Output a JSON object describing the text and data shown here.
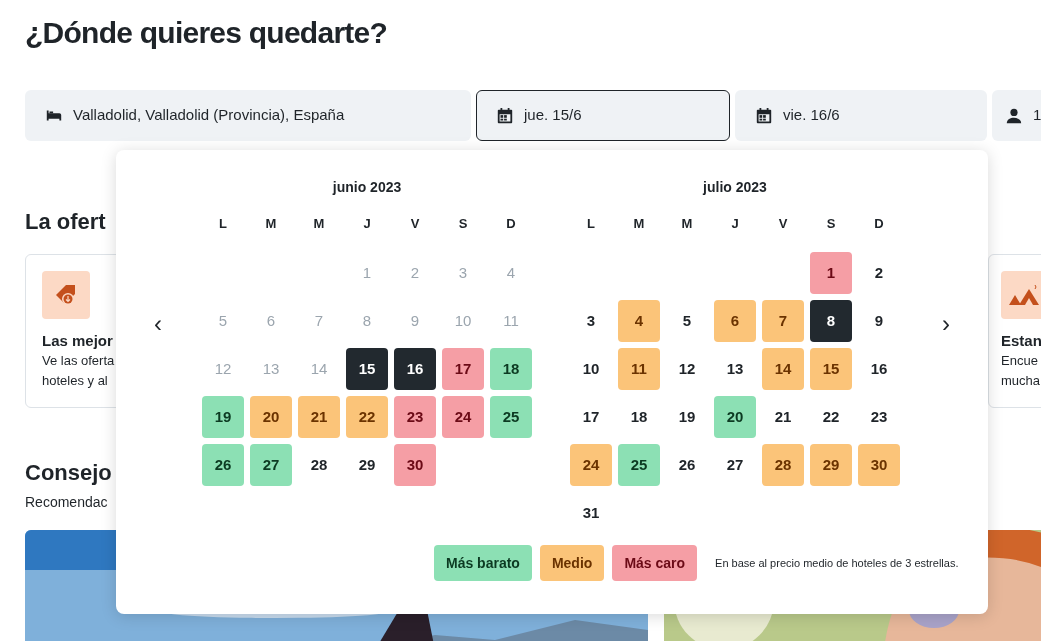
{
  "title": "¿Dónde quieres quedarte?",
  "search_fields": [
    {
      "kind": "location",
      "value": "Valladolid, Valladolid (Provincia), España",
      "selected": false
    },
    {
      "kind": "date",
      "value": "jue. 15/6",
      "selected": true
    },
    {
      "kind": "date",
      "value": "vie. 16/6",
      "selected": false
    },
    {
      "kind": "guests",
      "value": "1",
      "selected": false
    }
  ],
  "offers": {
    "heading": "La ofert",
    "cards": [
      {
        "title": "Las mejor",
        "text_lines": [
          "Ve las oferta",
          "hoteles y al"
        ]
      },
      {
        "title": "Estan",
        "text_lines": [
          "Encue",
          "mucha"
        ]
      }
    ]
  },
  "tips": {
    "heading": "Consejo",
    "subtitle": "Recomendac"
  },
  "calendar": {
    "prev": "‹",
    "next": "›",
    "months": [
      {
        "title": "junio 2023",
        "weekdays": [
          "L",
          "M",
          "M",
          "J",
          "V",
          "S",
          "D"
        ],
        "weeks": [
          [
            {
              "kind": "empty"
            },
            {
              "kind": "empty"
            },
            {
              "kind": "empty"
            },
            {
              "d": "1",
              "kind": "past"
            },
            {
              "d": "2",
              "kind": "past"
            },
            {
              "d": "3",
              "kind": "past"
            },
            {
              "d": "4",
              "kind": "past"
            }
          ],
          [
            {
              "d": "5",
              "kind": "past"
            },
            {
              "d": "6",
              "kind": "past"
            },
            {
              "d": "7",
              "kind": "past"
            },
            {
              "d": "8",
              "kind": "past"
            },
            {
              "d": "9",
              "kind": "past"
            },
            {
              "d": "10",
              "kind": "past"
            },
            {
              "d": "11",
              "kind": "past"
            }
          ],
          [
            {
              "d": "12",
              "kind": "past"
            },
            {
              "d": "13",
              "kind": "past"
            },
            {
              "d": "14",
              "kind": "past"
            },
            {
              "d": "15",
              "kind": "selected"
            },
            {
              "d": "16",
              "kind": "selected"
            },
            {
              "d": "17",
              "kind": "expensive"
            },
            {
              "d": "18",
              "kind": "cheap"
            }
          ],
          [
            {
              "d": "19",
              "kind": "cheap"
            },
            {
              "d": "20",
              "kind": "medium"
            },
            {
              "d": "21",
              "kind": "medium"
            },
            {
              "d": "22",
              "kind": "medium"
            },
            {
              "d": "23",
              "kind": "expensive"
            },
            {
              "d": "24",
              "kind": "expensive"
            },
            {
              "d": "25",
              "kind": "cheap"
            }
          ],
          [
            {
              "d": "26",
              "kind": "cheap"
            },
            {
              "d": "27",
              "kind": "cheap"
            },
            {
              "d": "28",
              "kind": "plain"
            },
            {
              "d": "29",
              "kind": "plain"
            },
            {
              "d": "30",
              "kind": "expensive"
            }
          ]
        ]
      },
      {
        "title": "julio 2023",
        "weekdays": [
          "L",
          "M",
          "M",
          "J",
          "V",
          "S",
          "D"
        ],
        "weeks": [
          [
            {
              "kind": "empty"
            },
            {
              "kind": "empty"
            },
            {
              "kind": "empty"
            },
            {
              "kind": "empty"
            },
            {
              "kind": "empty"
            },
            {
              "d": "1",
              "kind": "expensive"
            },
            {
              "d": "2",
              "kind": "plain"
            }
          ],
          [
            {
              "d": "3",
              "kind": "plain"
            },
            {
              "d": "4",
              "kind": "medium"
            },
            {
              "d": "5",
              "kind": "plain"
            },
            {
              "d": "6",
              "kind": "medium"
            },
            {
              "d": "7",
              "kind": "medium"
            },
            {
              "d": "8",
              "kind": "selected"
            },
            {
              "d": "9",
              "kind": "plain"
            }
          ],
          [
            {
              "d": "10",
              "kind": "plain"
            },
            {
              "d": "11",
              "kind": "medium"
            },
            {
              "d": "12",
              "kind": "plain"
            },
            {
              "d": "13",
              "kind": "plain"
            },
            {
              "d": "14",
              "kind": "medium"
            },
            {
              "d": "15",
              "kind": "medium"
            },
            {
              "d": "16",
              "kind": "plain"
            }
          ],
          [
            {
              "d": "17",
              "kind": "plain"
            },
            {
              "d": "18",
              "kind": "plain"
            },
            {
              "d": "19",
              "kind": "plain"
            },
            {
              "d": "20",
              "kind": "cheap"
            },
            {
              "d": "21",
              "kind": "plain"
            },
            {
              "d": "22",
              "kind": "plain"
            },
            {
              "d": "23",
              "kind": "plain"
            }
          ],
          [
            {
              "d": "24",
              "kind": "medium"
            },
            {
              "d": "25",
              "kind": "cheap"
            },
            {
              "d": "26",
              "kind": "plain"
            },
            {
              "d": "27",
              "kind": "plain"
            },
            {
              "d": "28",
              "kind": "medium"
            },
            {
              "d": "29",
              "kind": "medium"
            },
            {
              "d": "30",
              "kind": "medium"
            }
          ],
          [
            {
              "d": "31",
              "kind": "plain"
            }
          ]
        ]
      }
    ],
    "legend": [
      {
        "label": "Más barato",
        "kind": "cheap"
      },
      {
        "label": "Medio",
        "kind": "medium"
      },
      {
        "label": "Más caro",
        "kind": "expensive"
      }
    ],
    "note": "En base al precio medio de hoteles de 3 estrellas."
  }
}
